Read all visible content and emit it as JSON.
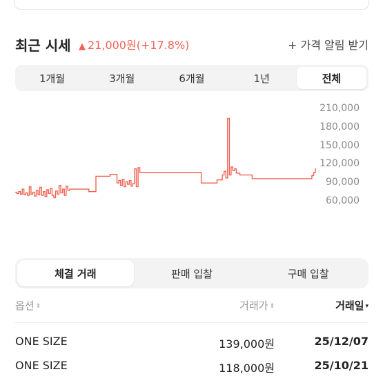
{
  "header": {
    "title": "최근 시세",
    "change_text": "21,000원(+17.8%)",
    "change_color": "#ef6253",
    "alert_label": "+ 가격 알림 받기"
  },
  "period_tabs": [
    {
      "label": "1개월",
      "active": false
    },
    {
      "label": "3개월",
      "active": false
    },
    {
      "label": "6개월",
      "active": false
    },
    {
      "label": "1년",
      "active": false
    },
    {
      "label": "전체",
      "active": true
    }
  ],
  "chart_data": {
    "type": "line",
    "title": "",
    "xlabel": "",
    "ylabel": "",
    "ylim": [
      60000,
      210000
    ],
    "y_ticks": [
      "210,000",
      "180,000",
      "150,000",
      "120,000",
      "90,000",
      "60,000"
    ],
    "grid": false,
    "color": "#ef6253",
    "series": [
      {
        "values": [
          75000,
          73000,
          76000,
          72000,
          80000,
          71000,
          74000,
          70000,
          84000,
          72000,
          75000,
          69000,
          78000,
          71000,
          83000,
          70000,
          76000,
          68000,
          79000,
          73000,
          81000,
          70000,
          66000,
          77000,
          72000,
          86000,
          74000,
          80000,
          70000,
          85000,
          78000,
          80000,
          80000,
          80000,
          80000,
          80000,
          80000,
          80000,
          80000,
          80000,
          80000,
          80000,
          76000,
          76000,
          76000,
          76000,
          101000,
          101000,
          101000,
          101000,
          101000,
          101000,
          101000,
          101000,
          104000,
          104000,
          104000,
          104000,
          90000,
          94000,
          86000,
          96000,
          84000,
          92000,
          88000,
          94000,
          85000,
          89000,
          113000,
          84000,
          115000,
          107000,
          107000,
          107000,
          107000,
          107000,
          107000,
          107000,
          107000,
          107000,
          107000,
          107000,
          107000,
          107000,
          107000,
          107000,
          107000,
          107000,
          107000,
          107000,
          107000,
          107000,
          107000,
          107000,
          107000,
          107000,
          107000,
          107000,
          107000,
          107000,
          107000,
          107000,
          107000,
          107000,
          107000,
          107000,
          90000,
          90000,
          90000,
          90000,
          90000,
          90000,
          90000,
          90000,
          90000,
          95000,
          95000,
          95000,
          103000,
          109000,
          98000,
          195000,
          103000,
          116000,
          110000,
          113000,
          106000,
          106000,
          103000,
          103000,
          103000,
          103000,
          103000,
          103000,
          103000,
          97000,
          97000,
          97000,
          97000,
          97000,
          97000,
          97000,
          97000,
          97000,
          97000,
          97000,
          97000,
          97000,
          97000,
          97000,
          97000,
          97000,
          97000,
          97000,
          97000,
          97000,
          97000,
          97000,
          97000,
          97000,
          97000,
          97000,
          97000,
          97000,
          97000,
          97000,
          97000,
          97000,
          97000,
          102000,
          107000,
          114000
        ]
      }
    ]
  },
  "trade_tabs": [
    {
      "label": "체결 거래",
      "active": true
    },
    {
      "label": "판매 입찰",
      "active": false
    },
    {
      "label": "구매 입찰",
      "active": false
    }
  ],
  "table": {
    "headers": {
      "option": "옵션",
      "price": "거래가",
      "date": "거래일"
    },
    "sort_icons": {
      "inactive": "⬍",
      "active": "▾"
    },
    "rows": [
      {
        "option": "ONE SIZE",
        "price": "139,000원",
        "date": "25/12/07"
      },
      {
        "option": "ONE SIZE",
        "price": "118,000원",
        "date": "25/10/21"
      }
    ]
  }
}
